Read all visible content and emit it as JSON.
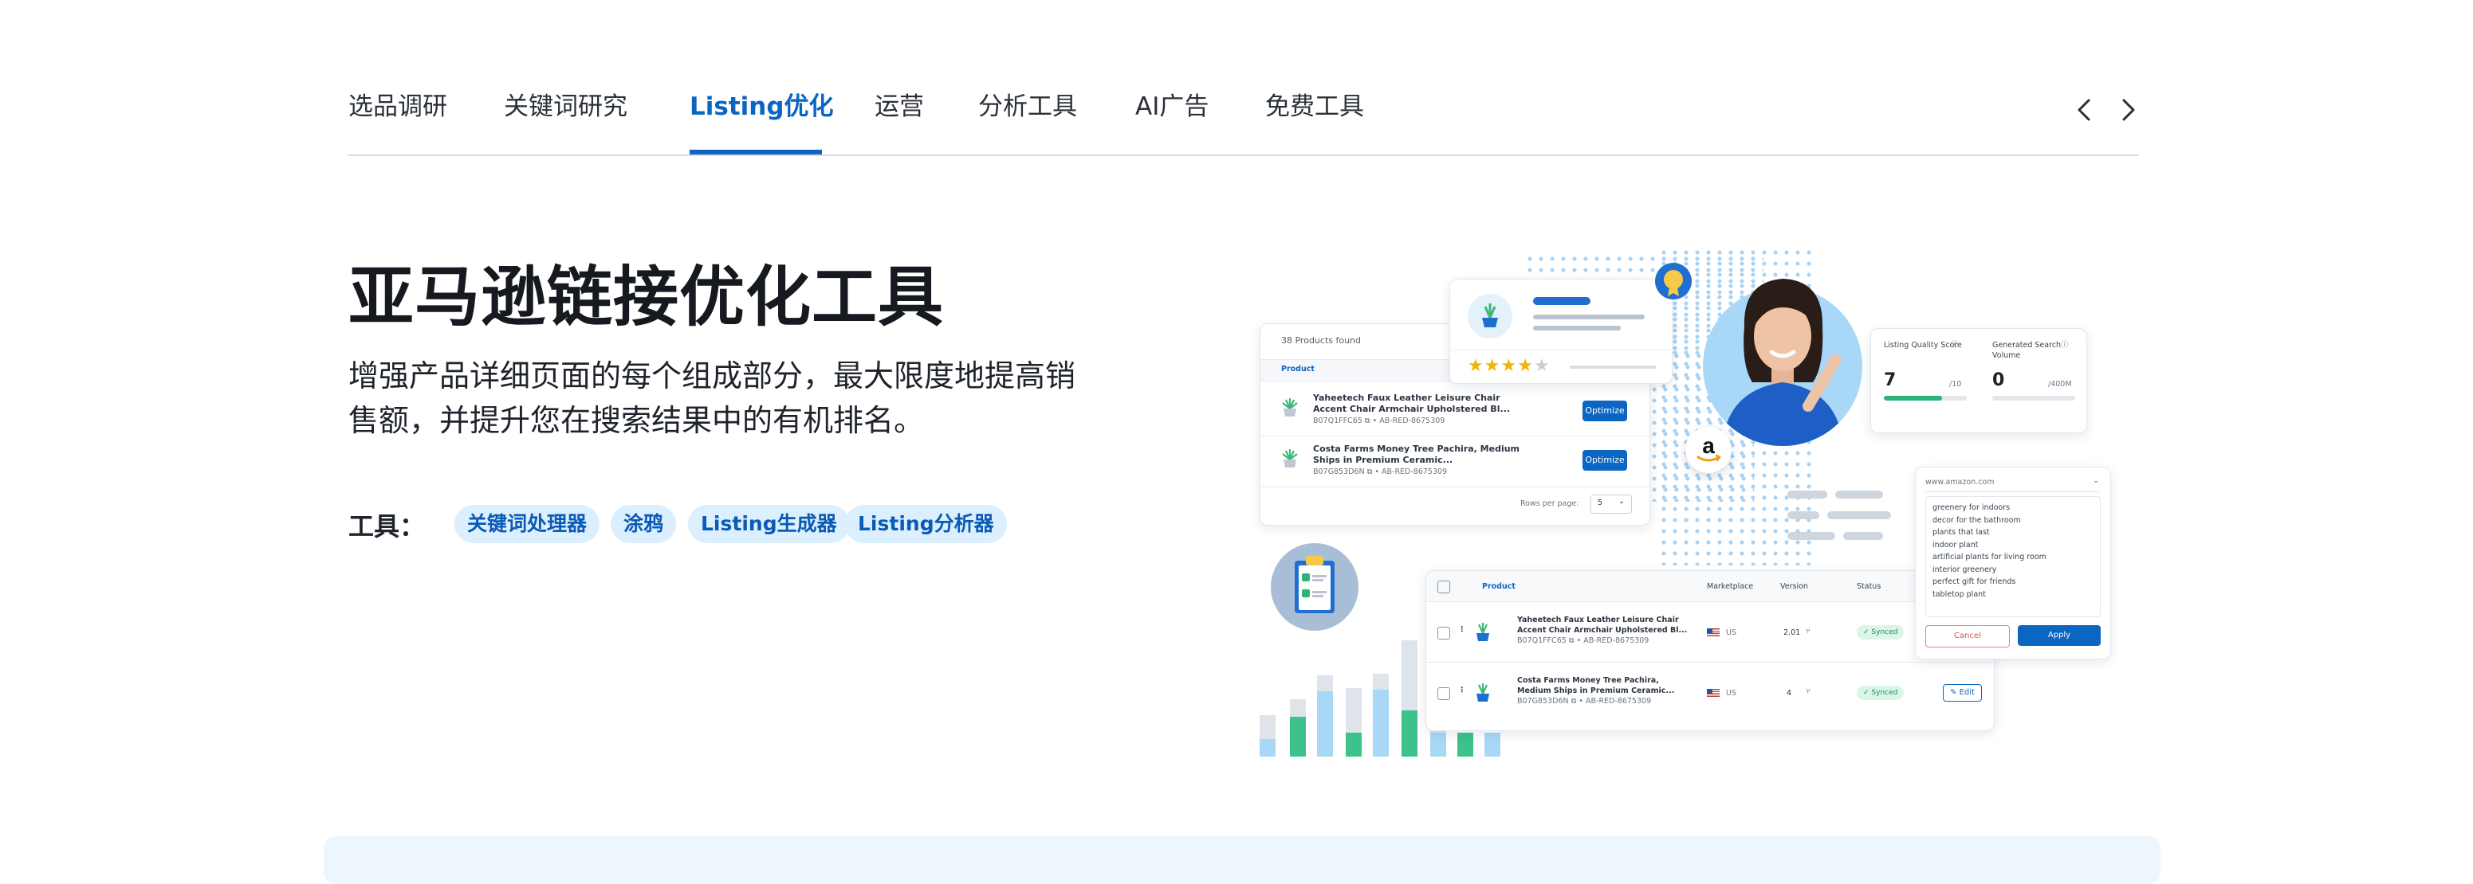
{
  "tabs": {
    "items": [
      {
        "label": "选品调研"
      },
      {
        "label": "关键词研究"
      },
      {
        "label": "Listing优化"
      },
      {
        "label": "运营"
      },
      {
        "label": "分析工具"
      },
      {
        "label": "AI广告"
      },
      {
        "label": "免费工具"
      }
    ],
    "active_index": 2
  },
  "hero": {
    "title": "亚马逊链接优化工具",
    "description": "增强产品详细页面的每个组成部分，最大限度地提高销售额，并提升您在搜索结果中的有机排名。",
    "tools_label": "工具：",
    "tools": [
      "关键词处理器",
      "涂鸦",
      "Listing生成器",
      "Listing分析器"
    ]
  },
  "illustration": {
    "products_card": {
      "found": "38 Products found",
      "column": "Product",
      "rows": [
        {
          "title": "Yaheetech Faux Leather Leisure Chair Accent Chair Armchair Upholstered Bl...",
          "meta": "B07Q1FFC65 ⧉ • AB-RED-8675309",
          "button": "Optimize"
        },
        {
          "title": "Costa Farms Money Tree Pachira, Medium Ships in Premium Ceramic...",
          "meta": "B07G853D6N ⧉ • AB-RED-8675309",
          "button": "Optimize"
        }
      ],
      "rows_per_page_label": "Rows per page:",
      "rows_per_page_value": "5"
    },
    "score_card": {
      "lqs_label": "Listing Quality Score",
      "lqs_value": "7",
      "lqs_max": "/10",
      "lqs_fraction": 0.7,
      "gsv_label": "Generated Search Volume",
      "gsv_value": "0",
      "gsv_max": "/400M"
    },
    "keyword_card": {
      "url": "www.amazon.com",
      "keywords": [
        "greenery for indoors",
        "decor for the bathroom",
        "plants that last",
        "indoor plant",
        "artificial plants for living room",
        "interior greenery",
        "perfect gift for friends",
        "tabletop plant"
      ],
      "cancel": "Cancel",
      "apply": "Apply"
    },
    "table_card": {
      "columns": [
        "Product",
        "Marketplace",
        "Version",
        "Status"
      ],
      "rows": [
        {
          "title1": "Yaheetech Faux Leather Leisure Chair",
          "title2": "Accent Chair Armchair Upholstered Bl...",
          "meta": "B07Q1FFC65 ⧉ • AB-RED-8675309",
          "marketplace": "US",
          "version": "2.01",
          "status": "Synced"
        },
        {
          "title1": "Costa Farms Money Tree Pachira,",
          "title2": "Medium Ships in Premium Ceramic...",
          "meta": "B07G853D6N ⧉ • AB-RED-8675309",
          "marketplace": "US",
          "version": "4",
          "status": "Synced",
          "action": "Edit"
        }
      ]
    },
    "rating_stars": 4
  },
  "colors": {
    "accent": "#0a66c2",
    "chip_bg": "#dcefff",
    "green": "#3cc28a",
    "light_blue": "#a8d7f7"
  }
}
